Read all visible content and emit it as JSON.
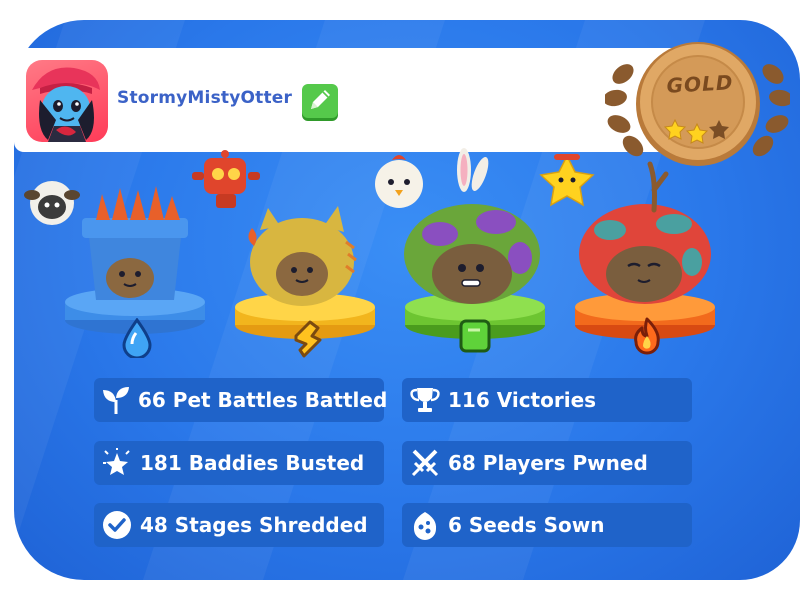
{
  "profile": {
    "username": "StormyMistyOtter",
    "edit_icon": "pencil-icon",
    "avatar_icon": "avatar-portrait"
  },
  "rank_badge": {
    "label": "GOLD",
    "stars_filled": 2,
    "stars_total": 3
  },
  "pets": [
    {
      "element_icon": "water-drop-icon",
      "element": "water",
      "pedestal_color": "#3d8de8"
    },
    {
      "element_icon": "lightning-icon",
      "element": "electric",
      "pedestal_color": "#f2b51d"
    },
    {
      "element_icon": "leaf-square-icon",
      "element": "plant",
      "pedestal_color": "#6dc531"
    },
    {
      "element_icon": "fire-icon",
      "element": "fire",
      "pedestal_color": "#f26a1c"
    }
  ],
  "stats": [
    {
      "icon": "sprout-icon",
      "text": "66 Pet Battles Battled"
    },
    {
      "icon": "trophy-icon",
      "text": "116 Victories"
    },
    {
      "icon": "burst-icon",
      "text": "181 Baddies Busted"
    },
    {
      "icon": "crossed-swords-icon",
      "text": "68 Players Pwned"
    },
    {
      "icon": "checkmark-icon",
      "text": "48 Stages Shredded"
    },
    {
      "icon": "seed-icon",
      "text": "6 Seeds Sown"
    }
  ],
  "colors": {
    "panel": "#2a78ea",
    "stat_box": "#1f63c9",
    "username": "#3b62c7",
    "edit_button": "#55c94b"
  }
}
